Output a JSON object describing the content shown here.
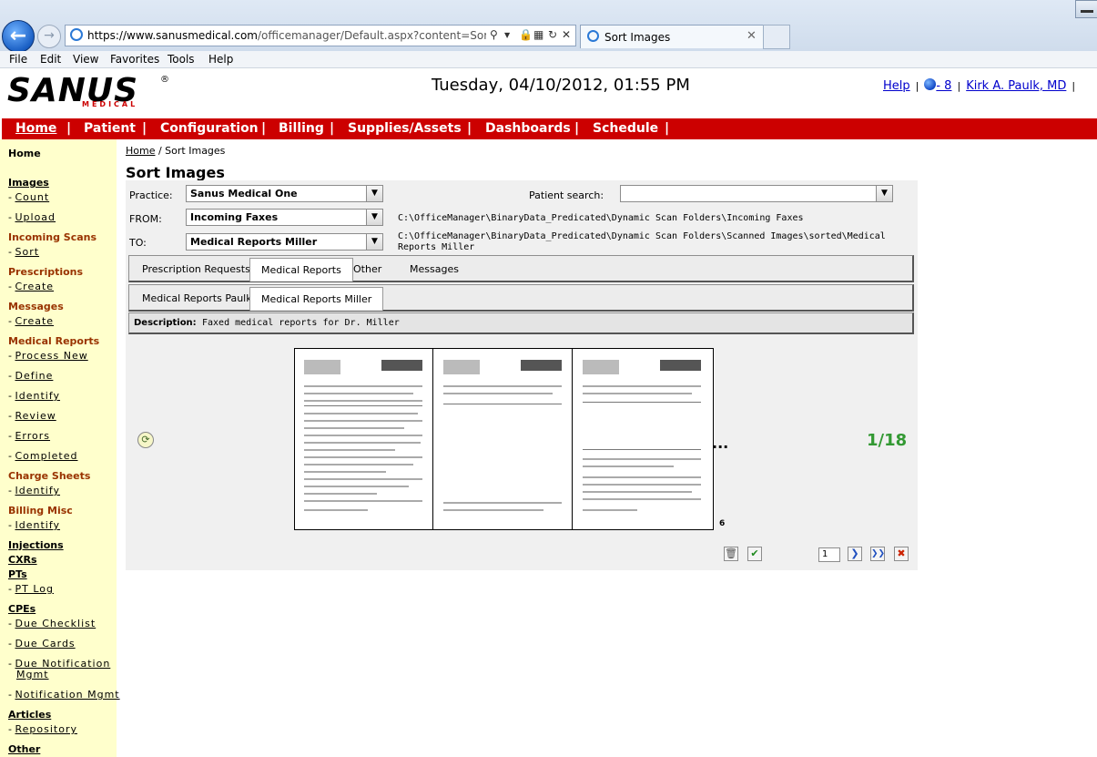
{
  "browser": {
    "url_main": "https://www.sanusmedical.com",
    "url_rest": "/officemanager/Default.aspx?content=SortImages",
    "tab_title": "Sort Images",
    "menu": [
      "File",
      "Edit",
      "View",
      "Favorites",
      "Tools",
      "Help"
    ]
  },
  "header": {
    "logo": "SANUS",
    "logo_sub": "MEDICAL",
    "logo_reg": "®",
    "datetime": "Tuesday, 04/10/2012, 01:55 PM",
    "help_link": "Help",
    "messages_count": "- 8",
    "user_name": "Kirk A. Paulk, MD",
    "sep": "|"
  },
  "nav": [
    "Home",
    "Patient",
    "Configuration",
    "Billing",
    "Supplies/Assets",
    "Dashboards",
    "Schedule"
  ],
  "sidebar": {
    "home": "Home",
    "images": "Images",
    "count": "Count",
    "upload": "Upload",
    "incoming_scans": "Incoming Scans",
    "sort": "Sort",
    "prescriptions": "Prescriptions",
    "prescriptions_create": "Create",
    "messages": "Messages",
    "messages_create": "Create",
    "medical_reports": "Medical Reports",
    "process_new": "Process New",
    "define": "Define",
    "identify": "Identify",
    "review": "Review",
    "errors": "Errors",
    "completed": "Completed",
    "charge_sheets": "Charge Sheets",
    "charge_identify": "Identify",
    "billing_misc": "Billing Misc",
    "billing_identify": "Identify",
    "injections": "Injections",
    "cxrs": "CXRs",
    "pts": "PTs",
    "pt_log": "PT Log",
    "cpes": "CPEs",
    "due_checklist": "Due Checklist",
    "due_cards": "Due Cards",
    "due_notification_1": "Due Notification",
    "due_notification_2": "Mgmt",
    "notification_mgmt": "Notification Mgmt",
    "articles": "Articles",
    "repository": "Repository",
    "other": "Other",
    "dash": "-"
  },
  "main": {
    "breadcrumb_home": "Home",
    "breadcrumb_rest": " / Sort Images",
    "title": "Sort Images",
    "practice_label": "Practice:",
    "practice_value": "Sanus Medical One",
    "patient_search_label": "Patient search:",
    "patient_search_value": "",
    "from_label": "FROM:",
    "from_value": "Incoming Faxes",
    "from_path": "C:\\OfficeManager\\BinaryData_Predicated\\Dynamic Scan Folders\\Incoming Faxes",
    "to_label": "TO:",
    "to_value": "Medical Reports Miller",
    "to_path_1": "C:\\OfficeManager\\BinaryData_Predicated\\Dynamic Scan Folders\\Scanned Images\\sorted\\Medical",
    "to_path_2": "Reports Miller",
    "tabs": [
      "Prescription Requests",
      "Medical Reports",
      "Other",
      "Messages"
    ],
    "subtabs": [
      "Medical Reports Paulk",
      "Medical Reports Miller"
    ],
    "description_label": "Description:",
    "description_value": "Faxed medical reports for Dr. Miller",
    "ellipsis": "...",
    "page_marker": "6",
    "counter": "1/18",
    "page_input_value": "1"
  },
  "colors": {
    "nav_red": "#cc0000",
    "sidebar_bg": "#ffffcc",
    "section_brown": "#993300",
    "counter_green": "#339933",
    "link_blue": "#0000cc"
  },
  "icons": {
    "rotate": "rotate-icon",
    "delete": "trash-icon",
    "approve": "check-icon",
    "next": "next-icon",
    "last": "last-icon",
    "cancel": "cancel-icon"
  }
}
